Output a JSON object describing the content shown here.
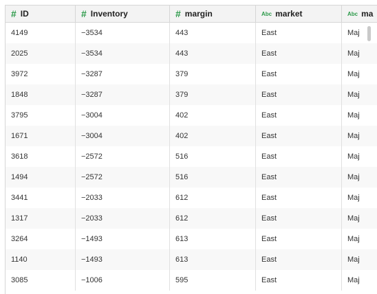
{
  "table": {
    "columns": [
      {
        "label": "ID",
        "type_icon": "#",
        "type_icon_name": "number-type-icon"
      },
      {
        "label": "Inventory",
        "type_icon": "#",
        "type_icon_name": "number-type-icon"
      },
      {
        "label": "margin",
        "type_icon": "#",
        "type_icon_name": "number-type-icon"
      },
      {
        "label": "market",
        "type_icon": "Abc",
        "type_icon_name": "text-type-icon"
      },
      {
        "label": "ma",
        "type_icon": "Abc",
        "type_icon_name": "text-type-icon"
      }
    ],
    "rows": [
      [
        "4149",
        "−3534",
        "443",
        "East",
        "Maj"
      ],
      [
        "2025",
        "−3534",
        "443",
        "East",
        "Maj"
      ],
      [
        "3972",
        "−3287",
        "379",
        "East",
        "Maj"
      ],
      [
        "1848",
        "−3287",
        "379",
        "East",
        "Maj"
      ],
      [
        "3795",
        "−3004",
        "402",
        "East",
        "Maj"
      ],
      [
        "1671",
        "−3004",
        "402",
        "East",
        "Maj"
      ],
      [
        "3618",
        "−2572",
        "516",
        "East",
        "Maj"
      ],
      [
        "1494",
        "−2572",
        "516",
        "East",
        "Maj"
      ],
      [
        "3441",
        "−2033",
        "612",
        "East",
        "Maj"
      ],
      [
        "1317",
        "−2033",
        "612",
        "East",
        "Maj"
      ],
      [
        "3264",
        "−1493",
        "613",
        "East",
        "Maj"
      ],
      [
        "1140",
        "−1493",
        "613",
        "East",
        "Maj"
      ],
      [
        "3085",
        "−1006",
        "595",
        "East",
        "Maj"
      ]
    ]
  },
  "colors": {
    "type_icon": "#2c9a4a",
    "header_bg": "#f3f3f3",
    "alt_row_bg": "#f8f8f8",
    "border": "#d6d6d6"
  }
}
